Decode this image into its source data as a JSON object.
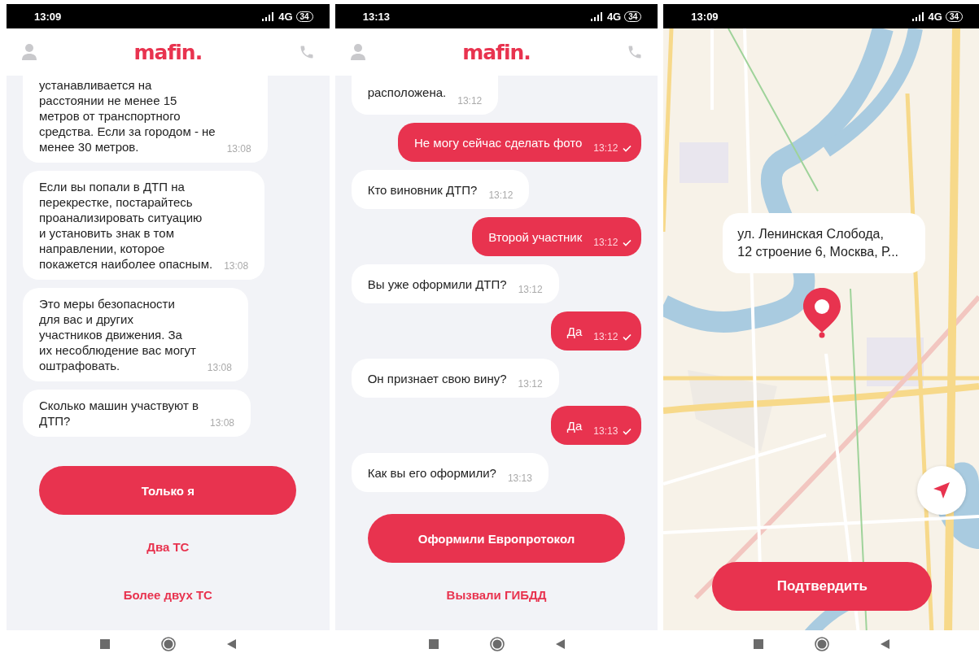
{
  "phones": [
    {
      "kind": "chat",
      "status": {
        "time": "13:09",
        "network": "4G",
        "battery": "34"
      },
      "logo": "mafin.",
      "messages": [
        {
          "kind": "bot",
          "text": "устанавливается на\nрасстоянии не менее 15\nметров от транспортного\nсредства. Если за городом - не\nменее 30 метров.",
          "time": "13:08"
        },
        {
          "kind": "bot",
          "text": "Если вы попали в ДТП на\nперекрестке, постарайтесь\nпроанализировать ситуацию\nи установить знак в том\nнаправлении, которое\nпокажется наиболее опасным.",
          "time": "13:08"
        },
        {
          "kind": "bot",
          "text": "Это меры безопасности\nдля вас и других\nучастников движения. За\nих несоблюдение вас могут\nоштрафовать.",
          "time": "13:08"
        },
        {
          "kind": "bot",
          "text": "Сколько машин участвуют в\nДТП?",
          "time": "13:08"
        }
      ],
      "actions": [
        {
          "kind": "primary",
          "label": "Только я"
        },
        {
          "kind": "link",
          "label": "Два ТС"
        },
        {
          "kind": "link",
          "label": "Более двух ТС"
        }
      ]
    },
    {
      "kind": "chat",
      "status": {
        "time": "13:13",
        "network": "4G",
        "battery": "34"
      },
      "logo": "mafin.",
      "messages": [
        {
          "kind": "bot",
          "text": "расположена.",
          "time": "13:12"
        },
        {
          "kind": "user",
          "text": "Не могу сейчас сделать фото",
          "time": "13:12",
          "delivered": true
        },
        {
          "kind": "bot",
          "text": "Кто виновник ДТП?",
          "time": "13:12"
        },
        {
          "kind": "user",
          "text": "Второй участник",
          "time": "13:12",
          "delivered": true
        },
        {
          "kind": "bot",
          "text": "Вы уже оформили ДТП?",
          "time": "13:12"
        },
        {
          "kind": "user",
          "text": "Да",
          "time": "13:12",
          "delivered": true
        },
        {
          "kind": "bot",
          "text": "Он признает свою вину?",
          "time": "13:12"
        },
        {
          "kind": "user",
          "text": "Да",
          "time": "13:13",
          "delivered": true
        },
        {
          "kind": "bot",
          "text": "Как вы его оформили?",
          "time": "13:13"
        }
      ],
      "actions": [
        {
          "kind": "primary",
          "label": "Оформили Европротокол"
        },
        {
          "kind": "link",
          "label": "Вызвали ГИБДД"
        }
      ]
    },
    {
      "kind": "map",
      "status": {
        "time": "13:09",
        "network": "4G",
        "battery": "34"
      },
      "address": "ул. Ленинская Слобода,\n12 строение 6, Москва, Р...",
      "confirm": "Подтвердить"
    }
  ]
}
